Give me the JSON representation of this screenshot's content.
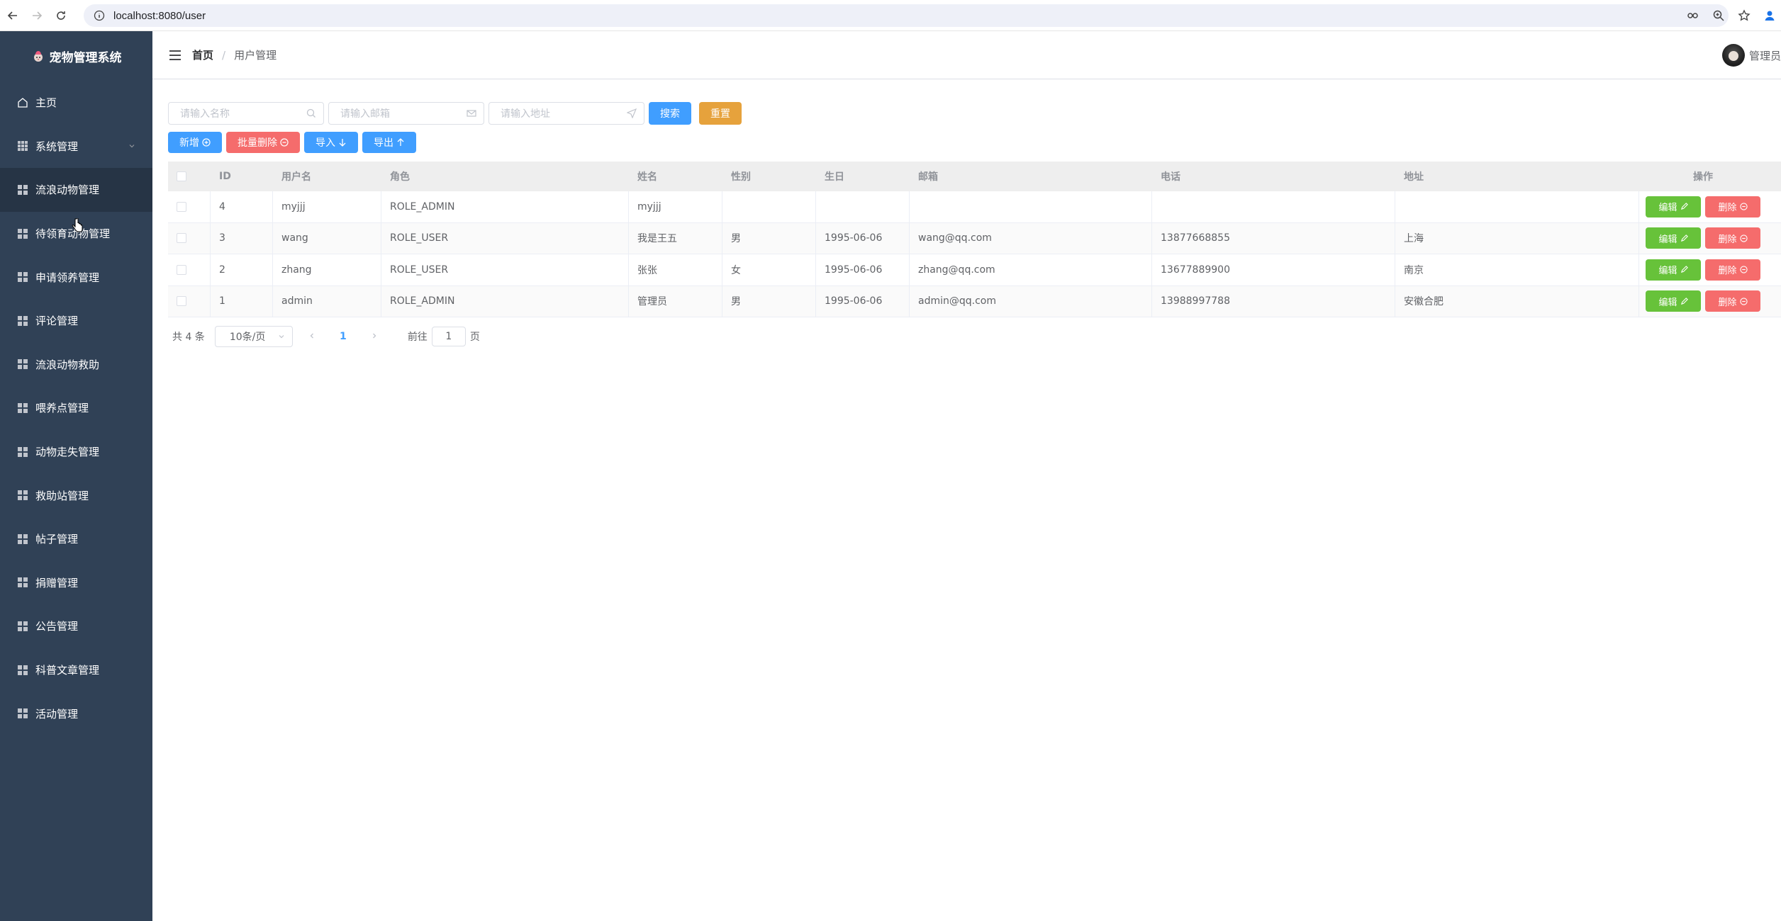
{
  "browser": {
    "url": "localhost:8080/user"
  },
  "sidebar": {
    "title": "宠物管理系统",
    "items": [
      {
        "label": "主页",
        "icon": "home-icon"
      },
      {
        "label": "系统管理",
        "icon": "grid-icon",
        "expandable": true
      },
      {
        "label": "流浪动物管理",
        "icon": "grid-icon"
      },
      {
        "label": "待领育动物管理",
        "icon": "grid-icon"
      },
      {
        "label": "申请领养管理",
        "icon": "grid-icon"
      },
      {
        "label": "评论管理",
        "icon": "grid-icon"
      },
      {
        "label": "流浪动物救助",
        "icon": "grid-icon"
      },
      {
        "label": "喂养点管理",
        "icon": "grid-icon"
      },
      {
        "label": "动物走失管理",
        "icon": "grid-icon"
      },
      {
        "label": "救助站管理",
        "icon": "grid-icon"
      },
      {
        "label": "帖子管理",
        "icon": "grid-icon"
      },
      {
        "label": "捐赠管理",
        "icon": "grid-icon"
      },
      {
        "label": "公告管理",
        "icon": "grid-icon"
      },
      {
        "label": "科普文章管理",
        "icon": "grid-icon"
      },
      {
        "label": "活动管理",
        "icon": "grid-icon"
      }
    ]
  },
  "header": {
    "breadcrumb_home": "首页",
    "breadcrumb_separator": "/",
    "breadcrumb_current": "用户管理",
    "user_name": "管理员"
  },
  "search": {
    "name_placeholder": "请输入名称",
    "email_placeholder": "请输入邮箱",
    "address_placeholder": "请输入地址",
    "search_label": "搜索",
    "reset_label": "重置"
  },
  "toolbar": {
    "add_label": "新增",
    "batch_delete_label": "批量删除",
    "import_label": "导入",
    "export_label": "导出"
  },
  "table": {
    "headers": {
      "id": "ID",
      "username": "用户名",
      "role": "角色",
      "name": "姓名",
      "sex": "性别",
      "birth": "生日",
      "email": "邮箱",
      "phone": "电话",
      "address": "地址",
      "ops": "操作"
    },
    "edit_label": "编辑",
    "delete_label": "删除",
    "rows": [
      {
        "id": "4",
        "username": "myjjj",
        "role": "ROLE_ADMIN",
        "name": "myjjj",
        "sex": "",
        "birth": "",
        "email": "",
        "phone": "",
        "address": ""
      },
      {
        "id": "3",
        "username": "wang",
        "role": "ROLE_USER",
        "name": "我是王五",
        "sex": "男",
        "birth": "1995-06-06",
        "email": "wang@qq.com",
        "phone": "13877668855",
        "address": "上海"
      },
      {
        "id": "2",
        "username": "zhang",
        "role": "ROLE_USER",
        "name": "张张",
        "sex": "女",
        "birth": "1995-06-06",
        "email": "zhang@qq.com",
        "phone": "13677889900",
        "address": "南京"
      },
      {
        "id": "1",
        "username": "admin",
        "role": "ROLE_ADMIN",
        "name": "管理员",
        "sex": "男",
        "birth": "1995-06-06",
        "email": "admin@qq.com",
        "phone": "13988997788",
        "address": "安徽合肥"
      }
    ]
  },
  "pagination": {
    "total_text": "共 4 条",
    "page_size": "10条/页",
    "current_page": "1",
    "goto_prefix": "前往",
    "goto_value": "1",
    "goto_suffix": "页"
  },
  "colors": {
    "sidebar_bg": "#304156",
    "primary": "#409eff",
    "warning": "#e6a23c",
    "danger": "#f56c6c",
    "success": "#67c23a"
  }
}
